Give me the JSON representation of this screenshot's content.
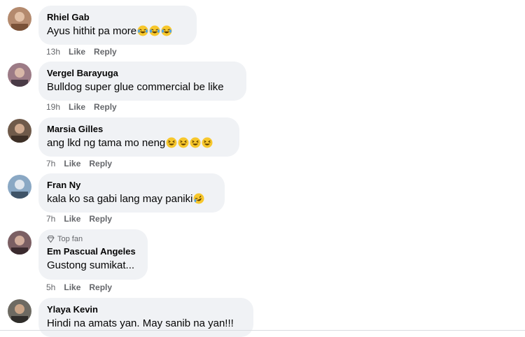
{
  "comments": [
    {
      "author": "Rhiel Gab",
      "text": "Ayus hithit pa more",
      "emojis": [
        "laughing-tears",
        "laughing-tears",
        "laughing-tears"
      ],
      "time": "13h",
      "like": "Like",
      "reply": "Reply"
    },
    {
      "author": "Vergel Barayuga",
      "text": "Bulldog super glue commercial be like",
      "emojis": [],
      "time": "19h",
      "like": "Like",
      "reply": "Reply"
    },
    {
      "author": "Marsia Gilles",
      "text": "ang lkd ng tama mo neng",
      "emojis": [
        "grinning-squint",
        "grinning-squint",
        "grinning-squint",
        "grinning-squint"
      ],
      "time": "7h",
      "like": "Like",
      "reply": "Reply"
    },
    {
      "author": "Fran Ny",
      "text": "kala ko sa gabi lang may paniki",
      "emojis": [
        "rolling-laughing"
      ],
      "time": "7h",
      "like": "Like",
      "reply": "Reply"
    },
    {
      "badge": "Top fan",
      "author": "Em Pascual Angeles",
      "text": "Gustong sumikat...",
      "emojis": [],
      "time": "5h",
      "like": "Like",
      "reply": "Reply"
    },
    {
      "author": "Ylaya Kevin",
      "text": "Hindi na amats yan. May sanib na yan!!!",
      "emojis": []
    }
  ],
  "colors": {
    "bubble": "#f0f2f5",
    "meta": "#65676b",
    "text": "#050505"
  }
}
